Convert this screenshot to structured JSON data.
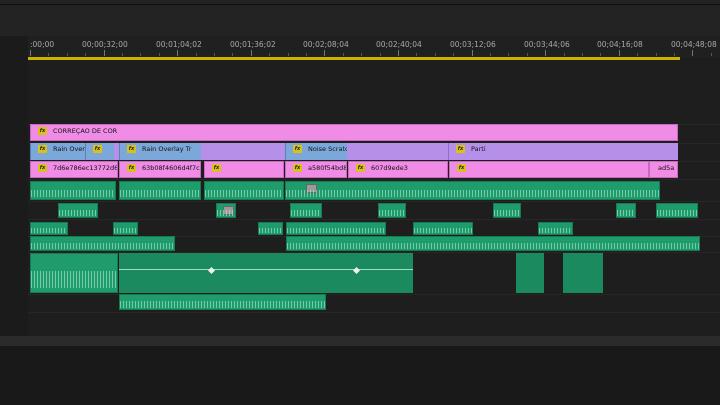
{
  "ruler": {
    "timecodes": [
      ":00;00",
      "00;00;32;00",
      "00;01;04;02",
      "00;01;36;02",
      "00;02;08;04",
      "00;02;40;04",
      "00;03;12;06",
      "00;03;44;06",
      "00;04;16;08",
      "00;04;48;08"
    ]
  },
  "clips": {
    "title": "CORREÇAO DE COR",
    "rain_over": "Rain Over",
    "rain_overlay": "Rain Overlay Tr",
    "noise": "Noise Scratc",
    "parti": "Parti",
    "id1": "7d6e786ec13772d6e",
    "id2": "63b08f4606d4f7c1",
    "id3": "a580f54bd8",
    "id4": "607d9ede3",
    "id5": "ad5a"
  },
  "colors": {
    "adjustment": "#f08ce6",
    "overlay": "#b690e8",
    "audio": "#1f9c6c",
    "work_area": "#c9b200"
  },
  "icons": [
    "fx-badge-icon",
    "keyframe-icon",
    "clip-thumbnail-icon"
  ]
}
